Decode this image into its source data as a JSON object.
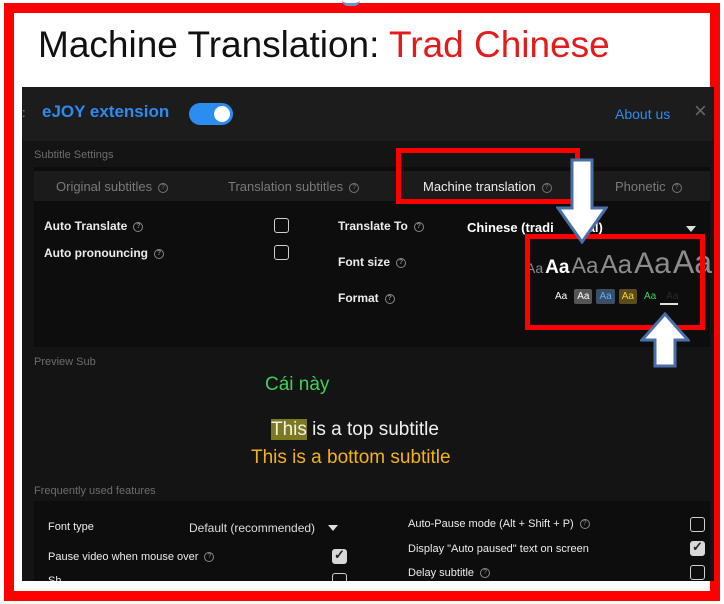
{
  "headline": {
    "prefix": "Machine Translation: ",
    "accent": "Trad Chinese"
  },
  "window": {
    "stub": ":",
    "brand": "eJOY extension",
    "about": "About us",
    "close": "×",
    "enabled": true
  },
  "subtitle_settings": {
    "section_label": "Subtitle Settings",
    "tabs": [
      "Original subtitles",
      "Translation subtitles",
      "Machine translation",
      "Phonetic"
    ],
    "active_tab": "Machine translation",
    "auto_translate": {
      "label": "Auto Translate",
      "checked": false
    },
    "auto_pronouncing": {
      "label": "Auto pronouncing",
      "checked": false
    },
    "translate_to": {
      "label": "Translate To",
      "value": "Chinese (tradi",
      "value_tail": "al)"
    },
    "font_size": {
      "label": "Font size",
      "options": [
        "Aa",
        "Aa",
        "Aa",
        "Aa",
        "Aa",
        "Aa"
      ],
      "selected_index": 1
    },
    "format": {
      "label": "Format",
      "options": [
        "Aa",
        "Aa",
        "Aa",
        "Aa",
        "Aa",
        "Aa"
      ],
      "selected_index": 4
    }
  },
  "preview": {
    "section_label": "Preview Sub",
    "machine_line": "Cái này",
    "top_line_highlight": "This",
    "top_line_rest": " is a top subtitle",
    "bottom_line": "This is a bottom subtitle"
  },
  "features": {
    "section_label": "Frequently used features",
    "font_type": {
      "label": "Font type",
      "value": "Default (recommended)"
    },
    "pause_video": {
      "label": "Pause video when mouse over",
      "checked": true
    },
    "third_item_partial": "Sh",
    "auto_pause": {
      "label": "Auto-Pause mode (Alt + Shift + P)",
      "checked": false
    },
    "display_auto_paused": {
      "label": "Display \"Auto paused\" text on screen",
      "checked": true
    },
    "delay_subtitle": {
      "label": "Delay subtitle",
      "checked": false
    }
  },
  "colors": {
    "frame": "#ff0000",
    "accent_text": "#e31b1b",
    "brand_blue": "#2d8cf0",
    "arrow_fill": "#ffffff",
    "arrow_stroke": "#4a6ea8",
    "preview_green": "#3ed05a",
    "preview_yellow": "#f2b21a",
    "highlight": "#7b7a1e"
  },
  "icons": [
    "help-icon",
    "close-icon",
    "chevron-down-icon",
    "arrow-down-annotation",
    "arrow-up-annotation"
  ]
}
